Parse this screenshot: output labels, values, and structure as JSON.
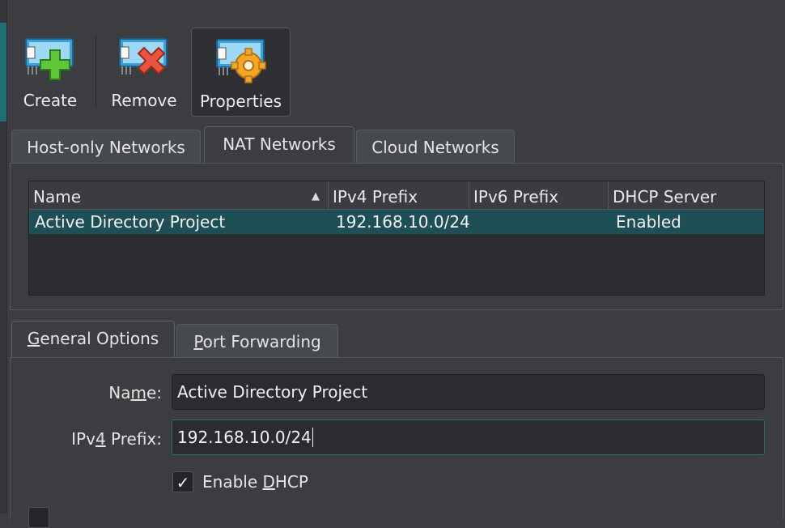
{
  "toolbar": {
    "create": {
      "label": "Create",
      "icon": "network-add-icon"
    },
    "remove": {
      "label": "Remove",
      "icon": "network-remove-icon"
    },
    "properties": {
      "label": "Properties",
      "icon": "network-properties-icon"
    }
  },
  "network_tabs": [
    {
      "label": "Host-only Networks"
    },
    {
      "label": "NAT Networks",
      "active": true
    },
    {
      "label": "Cloud Networks"
    }
  ],
  "table": {
    "columns": [
      "Name",
      "IPv4 Prefix",
      "IPv6 Prefix",
      "DHCP Server"
    ],
    "sort_column": "Name",
    "rows": [
      {
        "name": "Active Directory Project",
        "ipv4": "192.168.10.0/24",
        "ipv6": "",
        "dhcp": "Enabled",
        "selected": true
      }
    ]
  },
  "detail_tabs": {
    "general_pre": "",
    "general_mn": "G",
    "general_post": "eneral Options",
    "port_pre": "",
    "port_mn": "P",
    "port_post": "ort Forwarding"
  },
  "form": {
    "name_label_pre": "Na",
    "name_label_mn": "m",
    "name_label_post": "e:",
    "name_value": "Active Directory Project",
    "ipv4_label_pre": "IPv",
    "ipv4_label_mn": "4",
    "ipv4_label_post": " Prefix:",
    "ipv4_value": "192.168.10.0/24",
    "dhcp_check": "✓",
    "dhcp_label_pre": "Enable ",
    "dhcp_label_mn": "D",
    "dhcp_label_post": "HCP",
    "dhcp_checked": true
  },
  "colors": {
    "accent": "#1f6f75",
    "selection": "#1e4f56",
    "add_green": "#5fc83a",
    "remove_red": "#e8553f",
    "gear_orange": "#f5a623"
  }
}
